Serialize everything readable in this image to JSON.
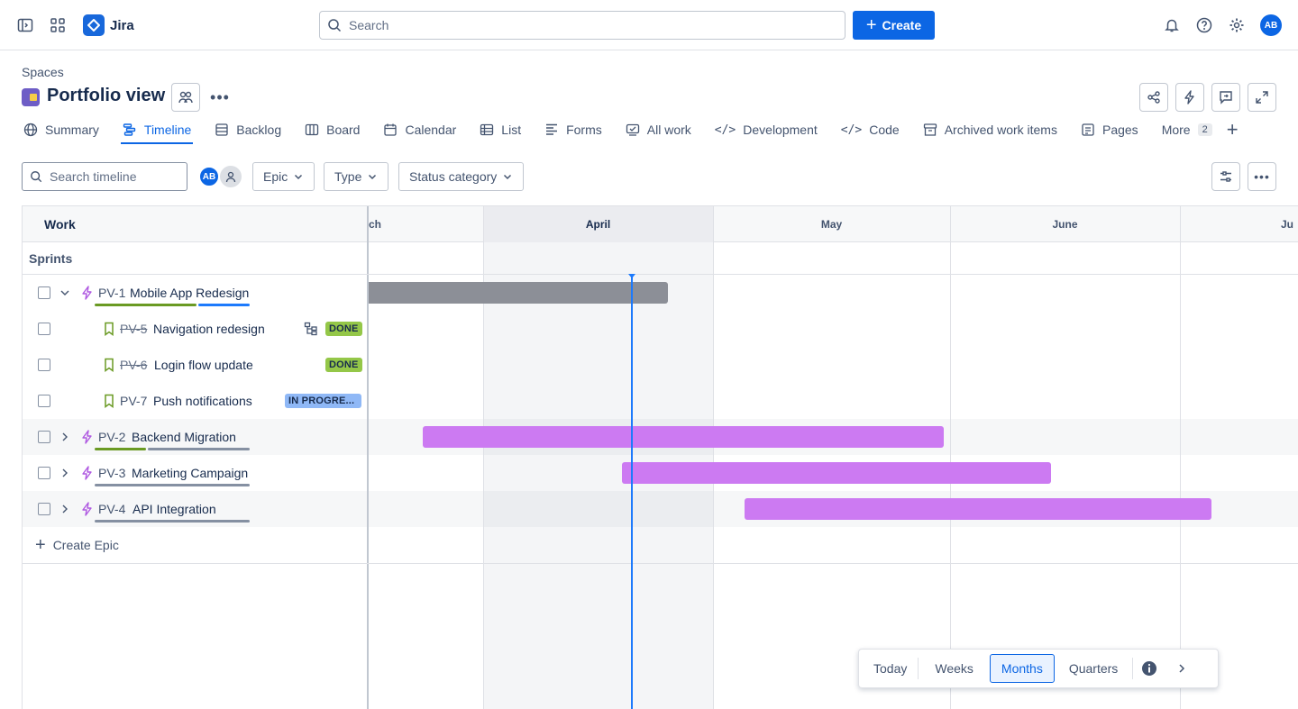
{
  "app": {
    "name": "Jira"
  },
  "search": {
    "placeholder": "Search"
  },
  "create_label": "Create",
  "user": {
    "initials": "AB"
  },
  "breadcrumb": "Spaces",
  "project": {
    "title": "Portfolio view"
  },
  "tabs": [
    {
      "label": "Summary",
      "icon": "globe-icon"
    },
    {
      "label": "Timeline",
      "icon": "timeline-icon",
      "active": true
    },
    {
      "label": "Backlog",
      "icon": "backlog-icon"
    },
    {
      "label": "Board",
      "icon": "board-icon"
    },
    {
      "label": "Calendar",
      "icon": "calendar-icon"
    },
    {
      "label": "List",
      "icon": "list-icon"
    },
    {
      "label": "Forms",
      "icon": "forms-icon"
    },
    {
      "label": "All work",
      "icon": "all-work-icon"
    },
    {
      "label": "Development",
      "icon": "code-icon"
    },
    {
      "label": "Code",
      "icon": "code-icon"
    },
    {
      "label": "Archived work items",
      "icon": "archive-icon"
    },
    {
      "label": "Pages",
      "icon": "pages-icon"
    },
    {
      "label": "More",
      "icon": "",
      "count": "2"
    }
  ],
  "toolbar": {
    "search_placeholder": "Search timeline",
    "filters": [
      "Epic",
      "Type",
      "Status category"
    ]
  },
  "grid": {
    "work_header": "Work",
    "sprints_label": "Sprints",
    "months": [
      "ch",
      "April",
      "May",
      "June",
      "Ju"
    ],
    "create_epic": "Create Epic"
  },
  "rows": [
    {
      "key": "PV-1",
      "title": "Mobile App Redesign",
      "type": "epic",
      "expanded": true
    },
    {
      "key": "PV-5",
      "title": "Navigation redesign",
      "type": "story",
      "status": "DONE",
      "done": true
    },
    {
      "key": "PV-6",
      "title": "Login flow update",
      "type": "story",
      "status": "DONE",
      "done": true
    },
    {
      "key": "PV-7",
      "title": "Push notifications",
      "type": "story",
      "status": "IN PROGRE..."
    },
    {
      "key": "PV-2",
      "title": "Backend Migration",
      "type": "epic"
    },
    {
      "key": "PV-3",
      "title": "Marketing Campaign",
      "type": "epic"
    },
    {
      "key": "PV-4",
      "title": "API Integration",
      "type": "epic"
    }
  ],
  "view_switcher": {
    "options": [
      "Today",
      "Weeks",
      "Months",
      "Quarters"
    ],
    "selected": "Months"
  },
  "colors": {
    "primary": "#0c66e4",
    "epic_bar": "#cc7af2",
    "done_bar": "#8c8f97",
    "done_badge": "#94c748",
    "progress_badge": "#8fb8f6"
  }
}
